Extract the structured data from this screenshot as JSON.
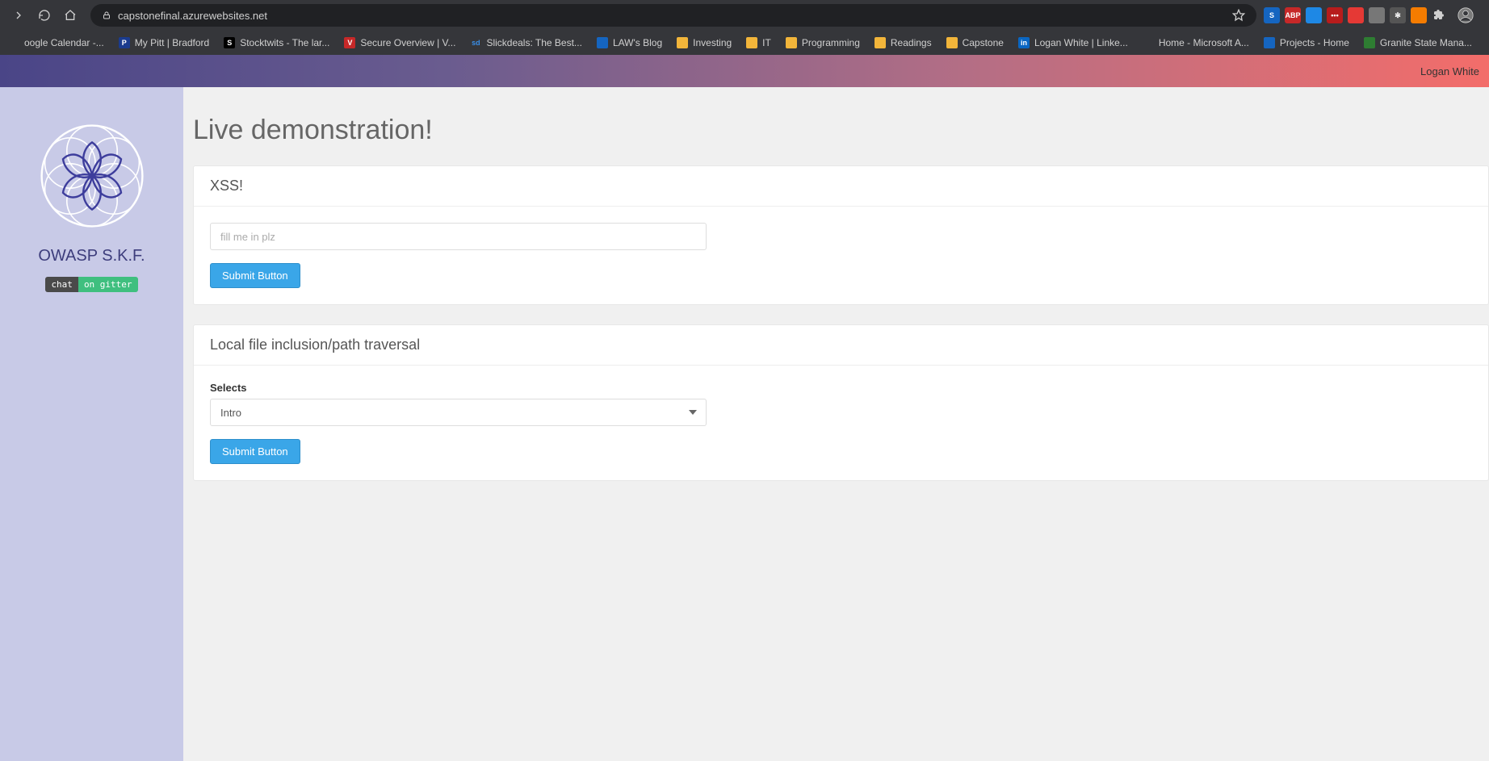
{
  "browser": {
    "url": "capstonefinal.azurewebsites.net",
    "bookmarks": [
      {
        "label": "oogle Calendar -...",
        "icon_bg": "#35363a",
        "icon_fg": "#4285f4",
        "icon_text": ""
      },
      {
        "label": "My Pitt | Bradford",
        "icon_bg": "#1a3b8e",
        "icon_fg": "#fff",
        "icon_text": "P"
      },
      {
        "label": "Stocktwits - The lar...",
        "icon_bg": "#000",
        "icon_fg": "#fff",
        "icon_text": "S"
      },
      {
        "label": "Secure Overview | V...",
        "icon_bg": "#c62828",
        "icon_fg": "#fff",
        "icon_text": "V"
      },
      {
        "label": "Slickdeals: The Best...",
        "icon_bg": "#35363a",
        "icon_fg": "#3a8ee6",
        "icon_text": "sd"
      },
      {
        "label": "LAW's Blog",
        "icon_bg": "#1565c0",
        "icon_fg": "#fff",
        "icon_text": ""
      },
      {
        "label": "Investing",
        "icon_bg": "#f2b53a",
        "icon_fg": "#fff",
        "icon_text": ""
      },
      {
        "label": "IT",
        "icon_bg": "#f2b53a",
        "icon_fg": "#fff",
        "icon_text": ""
      },
      {
        "label": "Programming",
        "icon_bg": "#f2b53a",
        "icon_fg": "#fff",
        "icon_text": ""
      },
      {
        "label": "Readings",
        "icon_bg": "#f2b53a",
        "icon_fg": "#fff",
        "icon_text": ""
      },
      {
        "label": "Capstone",
        "icon_bg": "#f2b53a",
        "icon_fg": "#fff",
        "icon_text": ""
      },
      {
        "label": "Logan White | Linke...",
        "icon_bg": "#0a66c2",
        "icon_fg": "#fff",
        "icon_text": "in"
      },
      {
        "label": "Home - Microsoft A...",
        "icon_bg": "#35363a",
        "icon_fg": "#fff",
        "icon_text": ""
      },
      {
        "label": "Projects - Home",
        "icon_bg": "#1565c0",
        "icon_fg": "#fff",
        "icon_text": ""
      },
      {
        "label": "Granite State Mana...",
        "icon_bg": "#2e7d32",
        "icon_fg": "#fff",
        "icon_text": ""
      }
    ],
    "extensions": [
      {
        "bg": "#1565c0",
        "fg": "#fff",
        "text": "S"
      },
      {
        "bg": "#c62828",
        "fg": "#fff",
        "text": "ABP"
      },
      {
        "bg": "#1e88e5",
        "fg": "#fff",
        "text": ""
      },
      {
        "bg": "#b71c1c",
        "fg": "#fff",
        "text": "•••"
      },
      {
        "bg": "#e53935",
        "fg": "#fff",
        "text": ""
      },
      {
        "bg": "#777",
        "fg": "#fff",
        "text": ""
      },
      {
        "bg": "#555",
        "fg": "#fff",
        "text": "✻"
      },
      {
        "bg": "#f57c00",
        "fg": "#fff",
        "text": ""
      }
    ]
  },
  "banner": {
    "user": "Logan White"
  },
  "sidebar": {
    "title": "OWASP S.K.F.",
    "badge_left": "chat",
    "badge_right": "on gitter"
  },
  "page": {
    "heading": "Live demonstration!",
    "panels": {
      "xss": {
        "title": "XSS!",
        "input_placeholder": "fill me in plz",
        "submit_label": "Submit Button"
      },
      "lfi": {
        "title": "Local file inclusion/path traversal",
        "select_label": "Selects",
        "select_value": "Intro",
        "submit_label": "Submit Button"
      }
    }
  }
}
